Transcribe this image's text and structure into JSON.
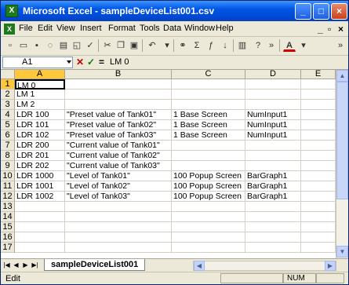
{
  "window": {
    "title": "Microsoft Excel - sampleDeviceList001.csv",
    "app_icon": "excel-icon",
    "min": "_",
    "max": "□",
    "close": "×"
  },
  "menubar": {
    "items": [
      "File",
      "Edit",
      "View",
      "Insert",
      "Format",
      "Tools",
      "Data",
      "Window",
      "Help"
    ],
    "min": "_",
    "restore": "▫",
    "close": "×"
  },
  "toolbar": {
    "icons": [
      "new-icon",
      "open-icon",
      "save-icon",
      "permission-icon",
      "print-icon",
      "print-preview-icon",
      "spelling-icon",
      "cut-icon",
      "copy-icon",
      "paste-icon",
      "undo-icon",
      "hyperlink-icon",
      "autosum-icon",
      "function-icon",
      "sort-ascending-icon",
      "chart-wizard-icon",
      "help-icon",
      "toolbar-options-icon",
      "font-color-icon",
      "more-buttons-icon"
    ]
  },
  "formulabar": {
    "cell_ref": "A1",
    "cancel_glyph": "✕",
    "enter_glyph": "✓",
    "equals_glyph": "=",
    "formula": "LM 0"
  },
  "grid": {
    "columns": [
      "A",
      "B",
      "C",
      "D",
      "E"
    ],
    "rows": [
      {
        "n": "1",
        "cells": [
          "LM 0",
          "",
          "",
          "",
          ""
        ]
      },
      {
        "n": "2",
        "cells": [
          "LM 1",
          "",
          "",
          "",
          ""
        ]
      },
      {
        "n": "3",
        "cells": [
          "LM 2",
          "",
          "",
          "",
          ""
        ]
      },
      {
        "n": "4",
        "cells": [
          "LDR 100",
          "\"Preset value of Tank01\"",
          "1 Base Screen",
          "NumInput1",
          ""
        ]
      },
      {
        "n": "5",
        "cells": [
          "LDR 101",
          "\"Preset value of Tank02\"",
          "1 Base Screen",
          "NumInput1",
          ""
        ]
      },
      {
        "n": "6",
        "cells": [
          "LDR 102",
          "\"Preset value of Tank03\"",
          "1 Base Screen",
          "NumInput1",
          ""
        ]
      },
      {
        "n": "7",
        "cells": [
          "LDR 200",
          "\"Current value of Tank01\"",
          "",
          "",
          ""
        ]
      },
      {
        "n": "8",
        "cells": [
          "LDR 201",
          "\"Current value of Tank02\"",
          "",
          "",
          ""
        ]
      },
      {
        "n": "9",
        "cells": [
          "LDR 202",
          "\"Current value of Tank03\"",
          "",
          "",
          ""
        ]
      },
      {
        "n": "10",
        "cells": [
          "LDR 1000",
          "\"Level of Tank01\"",
          "100 Popup Screen",
          "BarGraph1",
          ""
        ]
      },
      {
        "n": "11",
        "cells": [
          "LDR 1001",
          "\"Level of Tank02\"",
          "100 Popup Screen",
          "BarGraph1",
          ""
        ]
      },
      {
        "n": "12",
        "cells": [
          "LDR 1002",
          "\"Level of Tank03\"",
          "100 Popup Screen",
          "BarGraph1",
          ""
        ]
      },
      {
        "n": "13",
        "cells": [
          "",
          "",
          "",
          "",
          ""
        ]
      },
      {
        "n": "14",
        "cells": [
          "",
          "",
          "",
          "",
          ""
        ]
      },
      {
        "n": "15",
        "cells": [
          "",
          "",
          "",
          "",
          ""
        ]
      },
      {
        "n": "16",
        "cells": [
          "",
          "",
          "",
          "",
          ""
        ]
      },
      {
        "n": "17",
        "cells": [
          "",
          "",
          "",
          "",
          ""
        ]
      }
    ]
  },
  "sheets": {
    "tabs": [
      "sampleDeviceList001"
    ],
    "nav": [
      "|◀",
      "◀",
      "▶",
      "▶|"
    ]
  },
  "status": {
    "mode": "Edit",
    "num": "NUM"
  }
}
